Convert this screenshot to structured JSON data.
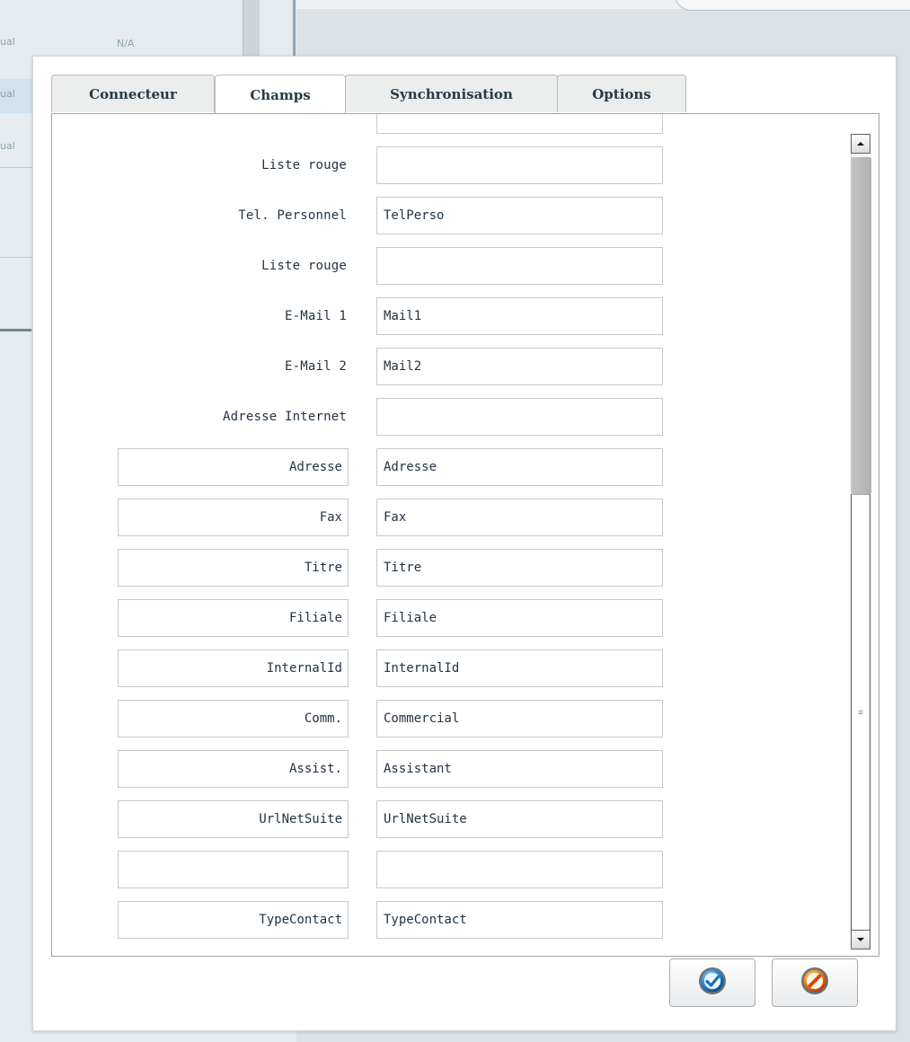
{
  "background": {
    "row_texts": [
      "ual",
      "N/A",
      "ual",
      "ual"
    ]
  },
  "tabs": [
    {
      "label": "Connecteur",
      "active": false
    },
    {
      "label": "Champs",
      "active": true
    },
    {
      "label": "Synchronisation",
      "active": false
    },
    {
      "label": "Options",
      "active": false
    }
  ],
  "rows": [
    {
      "label": "Liste rouge",
      "value": ""
    },
    {
      "label": "Tel. Personnel",
      "value": "TelPerso"
    },
    {
      "label": "Liste rouge",
      "value": ""
    },
    {
      "label": "E-Mail 1",
      "value": "Mail1"
    },
    {
      "label": "E-Mail 2",
      "value": "Mail2"
    },
    {
      "label": "Adresse Internet",
      "value": ""
    }
  ],
  "custom_rows": [
    {
      "label": "Adresse",
      "value": "Adresse"
    },
    {
      "label": "Fax",
      "value": "Fax"
    },
    {
      "label": "Titre",
      "value": "Titre"
    },
    {
      "label": "Filiale",
      "value": "Filiale"
    },
    {
      "label": "InternalId",
      "value": "InternalId"
    },
    {
      "label": "Comm.",
      "value": "Commercial"
    },
    {
      "label": "Assist.",
      "value": "Assistant"
    },
    {
      "label": "UrlNetSuite",
      "value": "UrlNetSuite"
    },
    {
      "label": "",
      "value": ""
    },
    {
      "label": "TypeContact",
      "value": "TypeContact"
    }
  ],
  "scrollbar": {
    "up_icon": "arrow-up-icon",
    "down_icon": "arrow-down-icon",
    "grip_icon": "grip-icon"
  },
  "buttons": {
    "ok_icon": "check-icon",
    "cancel_icon": "cancel-icon"
  }
}
